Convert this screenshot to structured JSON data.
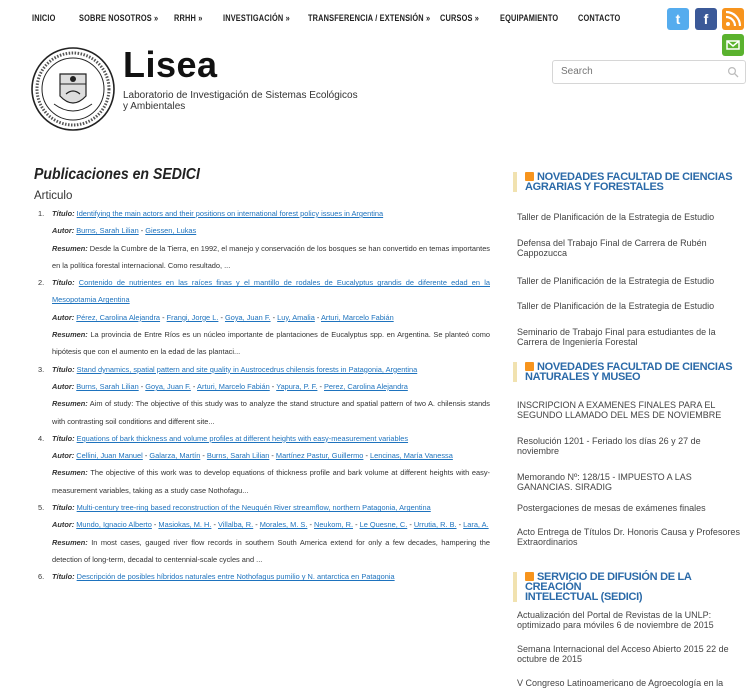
{
  "nav": {
    "items": [
      "INICIO",
      "SOBRE NOSOTROS »",
      "RRHH »",
      "INVESTIGACIÓN »",
      "TRANSFERENCIA / EXTENSIÓN »",
      "CURSOS »",
      "EQUIPAMIENTO",
      "CONTACTO"
    ]
  },
  "social": {
    "twitter": "t",
    "facebook": "f",
    "rss": "rss-icon",
    "mail": "mail-icon"
  },
  "header": {
    "title": "Lisea",
    "description": "Laboratorio de Investigación de Sistemas Ecológicos y Ambientales"
  },
  "search": {
    "placeholder": "Search"
  },
  "main": {
    "title": "Publicaciones en SEDICI",
    "section": "Articulo",
    "labels": {
      "title": "Título:",
      "author": "Autor:",
      "summary": "Resumen:"
    },
    "publications": [
      {
        "num": "1.",
        "title": "Identifying the main actors and their positions on international forest policy issues in Argentina",
        "authors": [
          "Burns, Sarah Lilian",
          "Giessen, Lukas"
        ],
        "summary": "Desde la Cumbre de la Tierra, en 1992, el manejo y conservación de los bosques se han convertido en temas importantes en la política forestal internacional. Como resultado, ..."
      },
      {
        "num": "2.",
        "title": "Contenido de nutrientes en las raíces finas y el mantillo de rodales de Eucalyptus grandis de diferente edad en la Mesopotamia Argentina",
        "authors": [
          "Pérez, Carolina Alejandra",
          "Frangi, Jorge L.",
          "Goya, Juan F.",
          "Luy, Amalia",
          "Arturi, Marcelo Fabián"
        ],
        "summary": "La provincia de Entre Ríos es un núcleo importante de plantaciones de Eucalyptus spp. en Argentina. Se planteó como hipótesis que con el aumento en la edad de las plantaci..."
      },
      {
        "num": "3.",
        "title": "Stand dynamics, spatial pattern and site quality in Austrocedrus chilensis forests in Patagonia, Argentina",
        "authors": [
          "Burns, Sarah Lilian",
          "Goya, Juan F.",
          "Arturi, Marcelo Fabián",
          "Yapura, P. F.",
          "Perez, Carolina Alejandra"
        ],
        "summary": "Aim of study: The objective of this study was to analyze the stand structure and spatial pattern of two A. chilensis stands with contrasting soil conditions and different site..."
      },
      {
        "num": "4.",
        "title": "Equations of bark thickness and volume profiles at different heights with easy-measurement variables",
        "authors": [
          "Cellini, Juan Manuel",
          "Galarza, Martín",
          "Burns, Sarah Lilian",
          "Martínez Pastur, Guillermo",
          "Lencinas, María Vanessa"
        ],
        "summary": "The objective of this work was to develop equations of thickness profile and bark volume at different heights with easy-measurement variables, taking as a study case Nothofagu..."
      },
      {
        "num": "5.",
        "title": "Multi-century tree-ring based reconstruction of the Neuquén River streamflow, northern Patagonia, Argentina",
        "authors": [
          "Mundo, Ignacio Alberto",
          "Masiokas, M. H.",
          "Villalba, R.",
          "Morales, M. S.",
          "Neukom, R.",
          "Le Quesne, C.",
          "Urrutia, R. B.",
          "Lara, A."
        ],
        "summary": "In most cases, gauged river flow records in southern South America extend for only a few decades, hampering the detection of long-term, decadal to centennial-scale cycles and ..."
      },
      {
        "num": "6.",
        "title": "Descripción de posibles híbridos naturales entre Nothofagus pumilio y N. antarctica en Patagonia"
      }
    ]
  },
  "sidebar": {
    "sections": [
      {
        "heading_line1": "NOVEDADES FACULTAD DE CIENCIAS",
        "heading_line2": "AGRARIAS Y FORESTALES",
        "items": [
          "Taller de Planificación de la Estrategia de Estudio",
          "Defensa del Trabajo Final de Carrera de Rubén Cappozucca",
          "Taller de Planificación de la Estrategia de Estudio",
          "Taller de Planificación de la Estrategia de Estudio",
          "Seminario de Trabajo Final para estudiantes de la Carrera de Ingeniería Forestal"
        ]
      },
      {
        "heading_line1": "NOVEDADES FACULTAD DE CIENCIAS",
        "heading_line2": "NATURALES Y MUSEO",
        "items": [
          "INSCRIPCION A EXAMENES FINALES PARA EL SEGUNDO LLAMADO DEL MES DE NOVIEMBRE",
          "Resolución 1201 - Feriado los días 26 y 27 de noviembre",
          "Memorando Nº: 128/15 - IMPUESTO A LAS GANANCIAS. SIRADIG",
          "Postergaciones de mesas de exámenes finales",
          "Acto Entrega de Títulos Dr. Honoris Causa y Profesores Extraordinarios"
        ]
      },
      {
        "heading_line1": "SERVICIO DE DIFUSIÓN DE LA CREACIÓN",
        "heading_line2": "INTELECTUAL (SEDICI)",
        "items": [
          "Actualización del Portal de Revistas de la UNLP: optimizado para móviles 6 de noviembre de 2015",
          "Semana Internacional del Acceso Abierto 2015 22 de octubre de 2015",
          "V Congreso Latinoamericano de Agroecología en la"
        ]
      }
    ]
  }
}
